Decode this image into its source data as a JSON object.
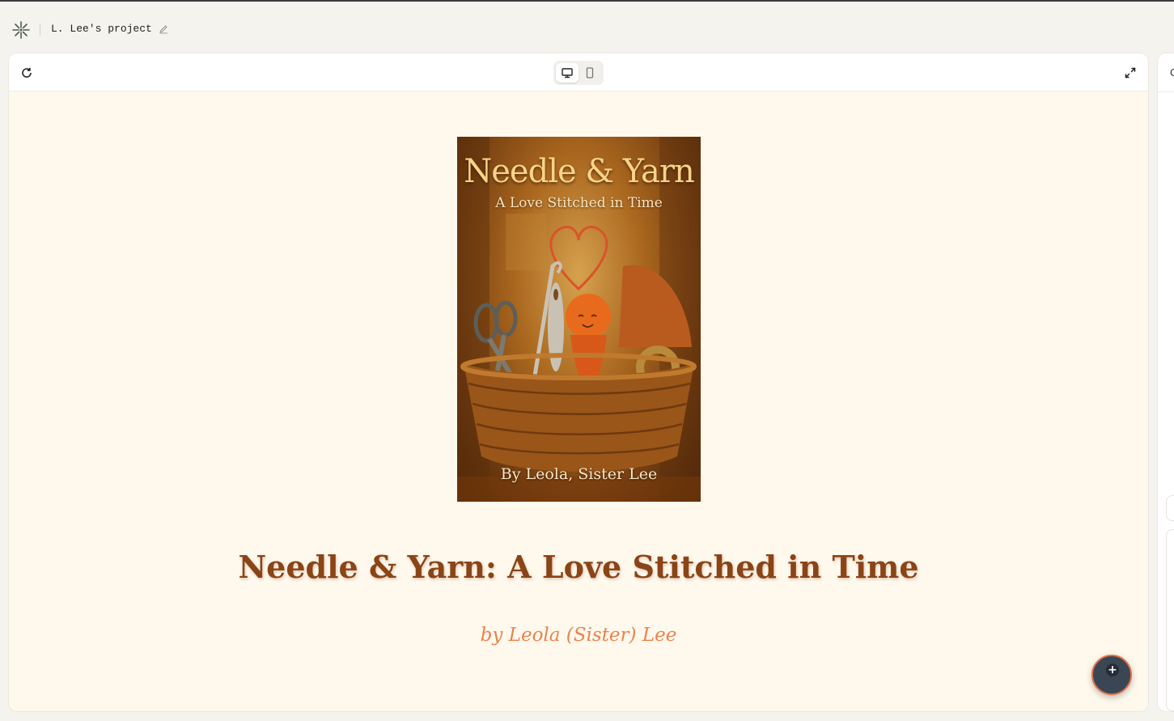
{
  "topbar": {
    "project_name": "L. Lee's project",
    "logo_icon": "asterisk-logo-icon",
    "edit_icon": "pencil-icon"
  },
  "preview_toolbar": {
    "reload_icon": "reload-icon",
    "device_modes": [
      "desktop",
      "mobile"
    ],
    "active_device": "desktop",
    "expand_icon": "expand-icon"
  },
  "book": {
    "cover_title": "Needle & Yarn",
    "cover_subtitle": "A Love Stitched in Time",
    "cover_author": "By Leola, Sister Lee",
    "title": "Needle & Yarn: A Love Stitched in Time",
    "byline": "by Leola (Sister) Lee"
  },
  "fab": {
    "symbol": "+"
  },
  "side_panel": {
    "glyph": "C"
  },
  "colors": {
    "page_background": "#fff8ec",
    "title": "#8a4416",
    "byline": "#e8834f",
    "fab": "#3b4654",
    "fab_ring": "#e2704a"
  }
}
